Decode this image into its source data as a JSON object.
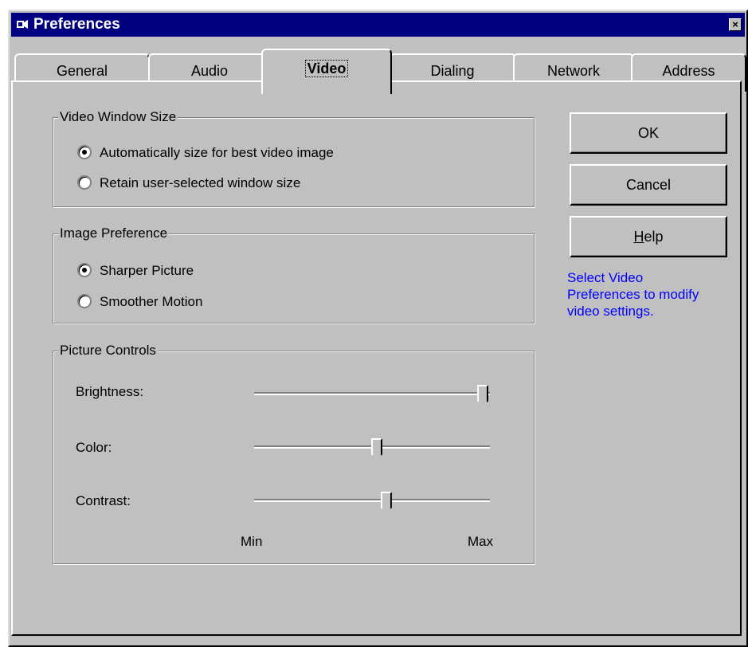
{
  "window": {
    "title": "Preferences",
    "close_label": "×"
  },
  "tabs": [
    {
      "label": "General"
    },
    {
      "label": "Audio"
    },
    {
      "label": "Video"
    },
    {
      "label": "Dialing"
    },
    {
      "label": "Network"
    },
    {
      "label": "Address"
    }
  ],
  "active_tab": "Video",
  "video_window_size": {
    "label": "Video Window Size",
    "options": [
      {
        "label": "Automatically size for best video image",
        "selected": true
      },
      {
        "label": "Retain user-selected window size",
        "selected": false
      }
    ]
  },
  "image_preference": {
    "label": "Image Preference",
    "options": [
      {
        "label": "Sharper Picture",
        "selected": true
      },
      {
        "label": "Smoother Motion",
        "selected": false
      }
    ]
  },
  "picture_controls": {
    "label": "Picture Controls",
    "sliders": [
      {
        "label": "Brightness:",
        "value": 0.97
      },
      {
        "label": "Color:",
        "value": 0.52
      },
      {
        "label": "Contrast:",
        "value": 0.56
      }
    ],
    "min_label": "Min",
    "max_label": "Max"
  },
  "buttons": {
    "ok": "OK",
    "cancel": "Cancel",
    "help_mnemonic": "H",
    "help_rest": "elp"
  },
  "hint": [
    "Select Video",
    "Preferences to modify",
    "video settings."
  ],
  "colors": {
    "title_bar": "#000080",
    "face": "#c0c0c0",
    "hint_text": "#0000ff"
  }
}
